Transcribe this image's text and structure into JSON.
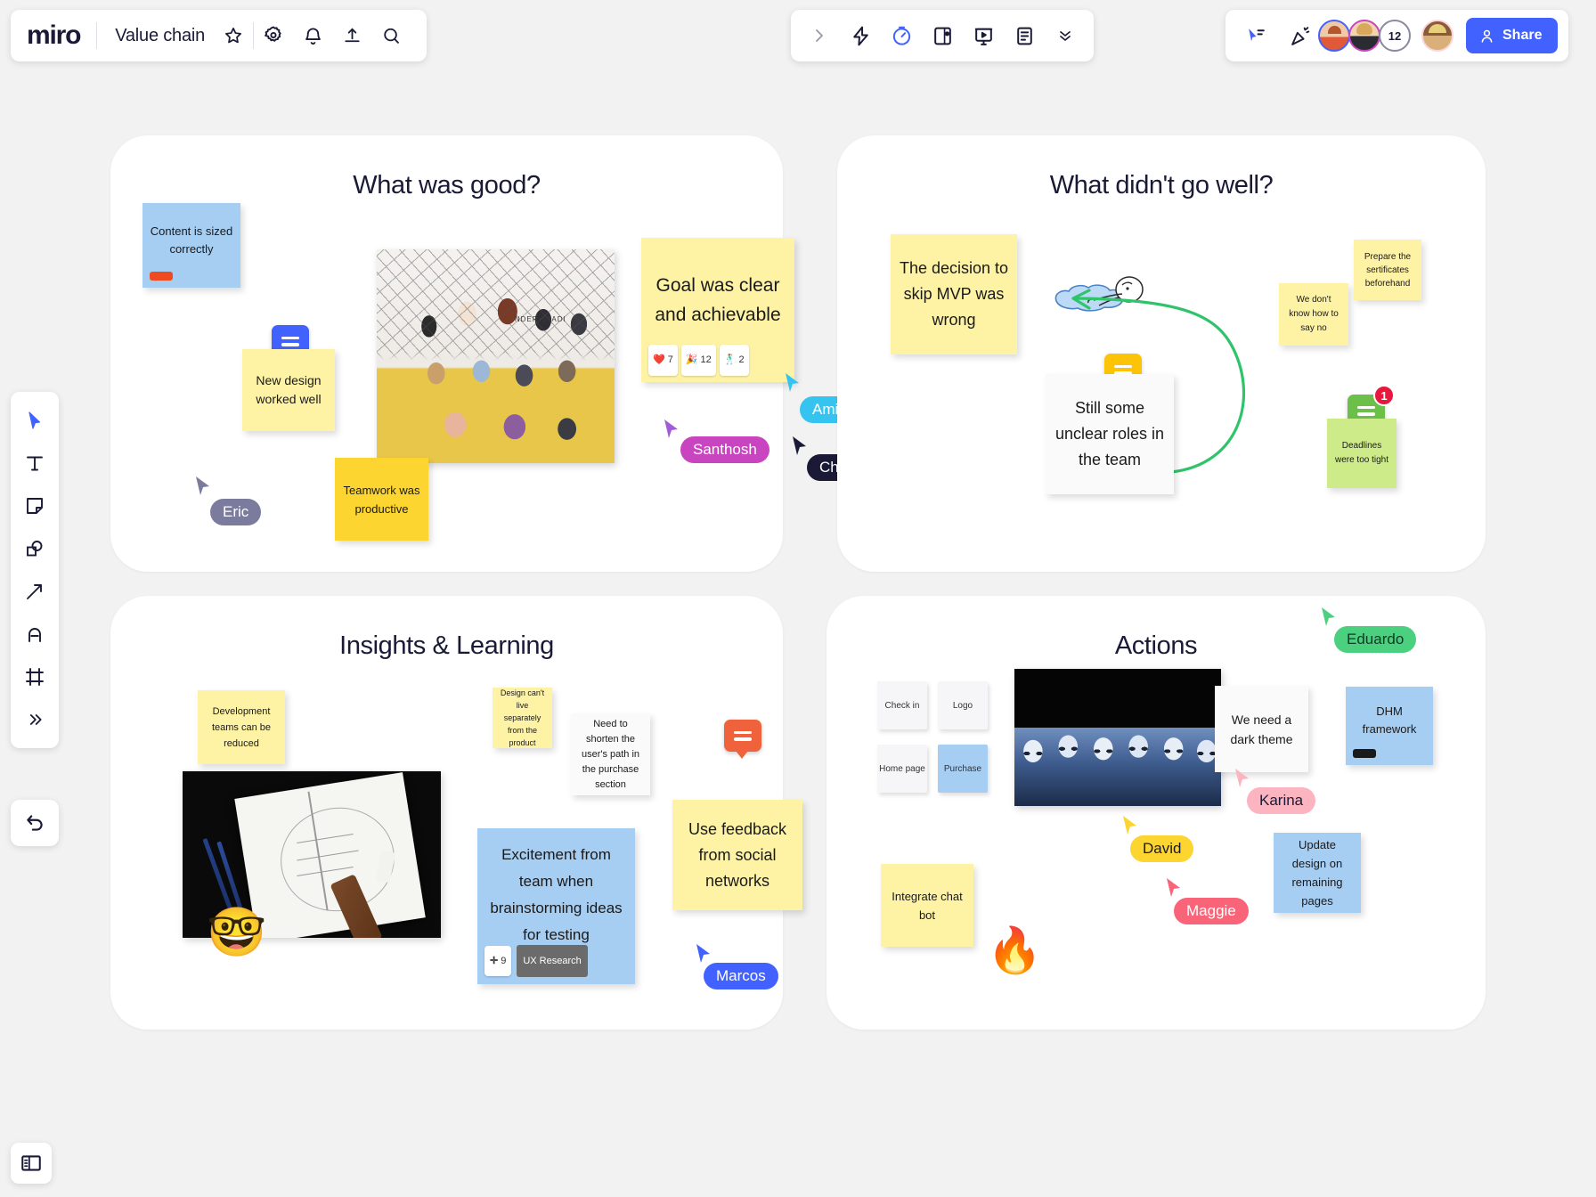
{
  "header": {
    "logo": "miro",
    "board_name": "Value chain",
    "icons": [
      "star-icon",
      "gear-icon",
      "bell-icon",
      "upload-icon",
      "search-icon"
    ]
  },
  "center_toolbar": {
    "icons": [
      "chevron-right-icon",
      "lightning-icon",
      "timer-icon",
      "note-panel-icon",
      "presentation-icon",
      "document-icon",
      "chevrons-down-icon"
    ]
  },
  "right_toolbar": {
    "icons": [
      "cursor-share-icon",
      "celebrate-icon"
    ],
    "collaborator_count": "12",
    "share_label": "Share"
  },
  "left_toolbar": {
    "tools": [
      {
        "name": "select-tool",
        "icon": "cursor-arrow-icon"
      },
      {
        "name": "text-tool",
        "icon": "text-t-icon"
      },
      {
        "name": "sticky-note-tool",
        "icon": "sticky-note-icon"
      },
      {
        "name": "shapes-tool",
        "icon": "shapes-icon"
      },
      {
        "name": "connection-line-tool",
        "icon": "arrow-icon"
      },
      {
        "name": "pen-tool",
        "icon": "pen-icon"
      },
      {
        "name": "frame-tool",
        "icon": "frame-icon"
      },
      {
        "name": "more-tools",
        "icon": "chevrons-right-icon"
      }
    ],
    "undo": "undo-icon",
    "panel_toggle": "panel-toggle-icon"
  },
  "frames": [
    {
      "id": "what-was-good",
      "title": "What was good?",
      "stickies": [
        {
          "text": "Content is sized correctly",
          "color": "blue",
          "color_bar": "#f04a23"
        },
        {
          "text": "New design worked well",
          "color": "yellow"
        },
        {
          "text": "Teamwork was productive",
          "color": "yellow2"
        },
        {
          "text": "Goal was clear and achievable",
          "color": "yellow",
          "reactions": [
            {
              "emoji": "❤️",
              "count": "7"
            },
            {
              "emoji": "🎉",
              "count": "12"
            },
            {
              "emoji": "🕺",
              "count": "2"
            }
          ]
        }
      ],
      "image_alt": "team-group-photo",
      "cursors": [
        {
          "name": "Eric",
          "color": "#7b7b9e"
        },
        {
          "name": "Santhosh",
          "color": "#c845bf"
        },
        {
          "name": "Amir",
          "color": "#35c4f0"
        },
        {
          "name": "Chris",
          "color": "#1a1a36"
        }
      ],
      "comment_bubbles": [
        {
          "color": "#4262ff"
        }
      ]
    },
    {
      "id": "what-didnt-go-well",
      "title": "What didn't go well?",
      "stickies": [
        {
          "text": "The decision to skip MVP was wrong",
          "color": "yellow"
        },
        {
          "text": "Still some unclear roles in the team",
          "color": "white"
        },
        {
          "text": "We don't know how to say no",
          "color": "yellow"
        },
        {
          "text": "Prepare the sertificates beforehand",
          "color": "yellow"
        },
        {
          "text": "Deadlines were too tight",
          "color": "green",
          "badge": "1"
        }
      ],
      "image_alt": "person-floating-on-water-sticker",
      "comment_bubbles": [
        {
          "color": "#fcc307"
        },
        {
          "color": "#6cc04a"
        }
      ]
    },
    {
      "id": "insights-and-learning",
      "title": "Insights & Learning",
      "stickies": [
        {
          "text": "Development teams can be reduced",
          "color": "yellow"
        },
        {
          "text": "Design can't live separately from the product",
          "color": "yellow"
        },
        {
          "text": "Need to shorten the user's path in the purchase section",
          "color": "white"
        },
        {
          "text": "Use feedback from social networks",
          "color": "yellow"
        },
        {
          "text": "Excitement from team when brainstorming ideas for testing",
          "color": "blue",
          "votes": "9",
          "tag": "UX Research"
        }
      ],
      "image_alt": "sketch-on-paper-with-pencils",
      "emoji": "🤓",
      "cursors": [
        {
          "name": "Marcos",
          "color": "#4262ff"
        }
      ],
      "comment_bubbles": [
        {
          "color": "#f0623c"
        }
      ]
    },
    {
      "id": "actions",
      "title": "Actions",
      "mini_cards": [
        {
          "label": "Check in",
          "color": "white"
        },
        {
          "label": "Logo",
          "color": "white"
        },
        {
          "label": "Home page",
          "color": "white"
        },
        {
          "label": "Purchase",
          "color": "blue"
        }
      ],
      "stickies": [
        {
          "text": "We need a dark theme",
          "color": "white"
        },
        {
          "text": "DHM framework",
          "color": "blue",
          "color_bar": "#1a1a1a"
        },
        {
          "text": "Update design on remaining pages",
          "color": "blue"
        },
        {
          "text": "Integrate chat bot",
          "color": "yellow"
        }
      ],
      "image_alt": "stormtroopers-photo",
      "emoji": "🔥",
      "cursors": [
        {
          "name": "Eduardo",
          "color": "#4ad07e"
        },
        {
          "name": "Karina",
          "color": "#fbb4c0"
        },
        {
          "name": "David",
          "color": "#fcd530"
        },
        {
          "name": "Maggie",
          "color": "#fa6478"
        }
      ]
    }
  ]
}
